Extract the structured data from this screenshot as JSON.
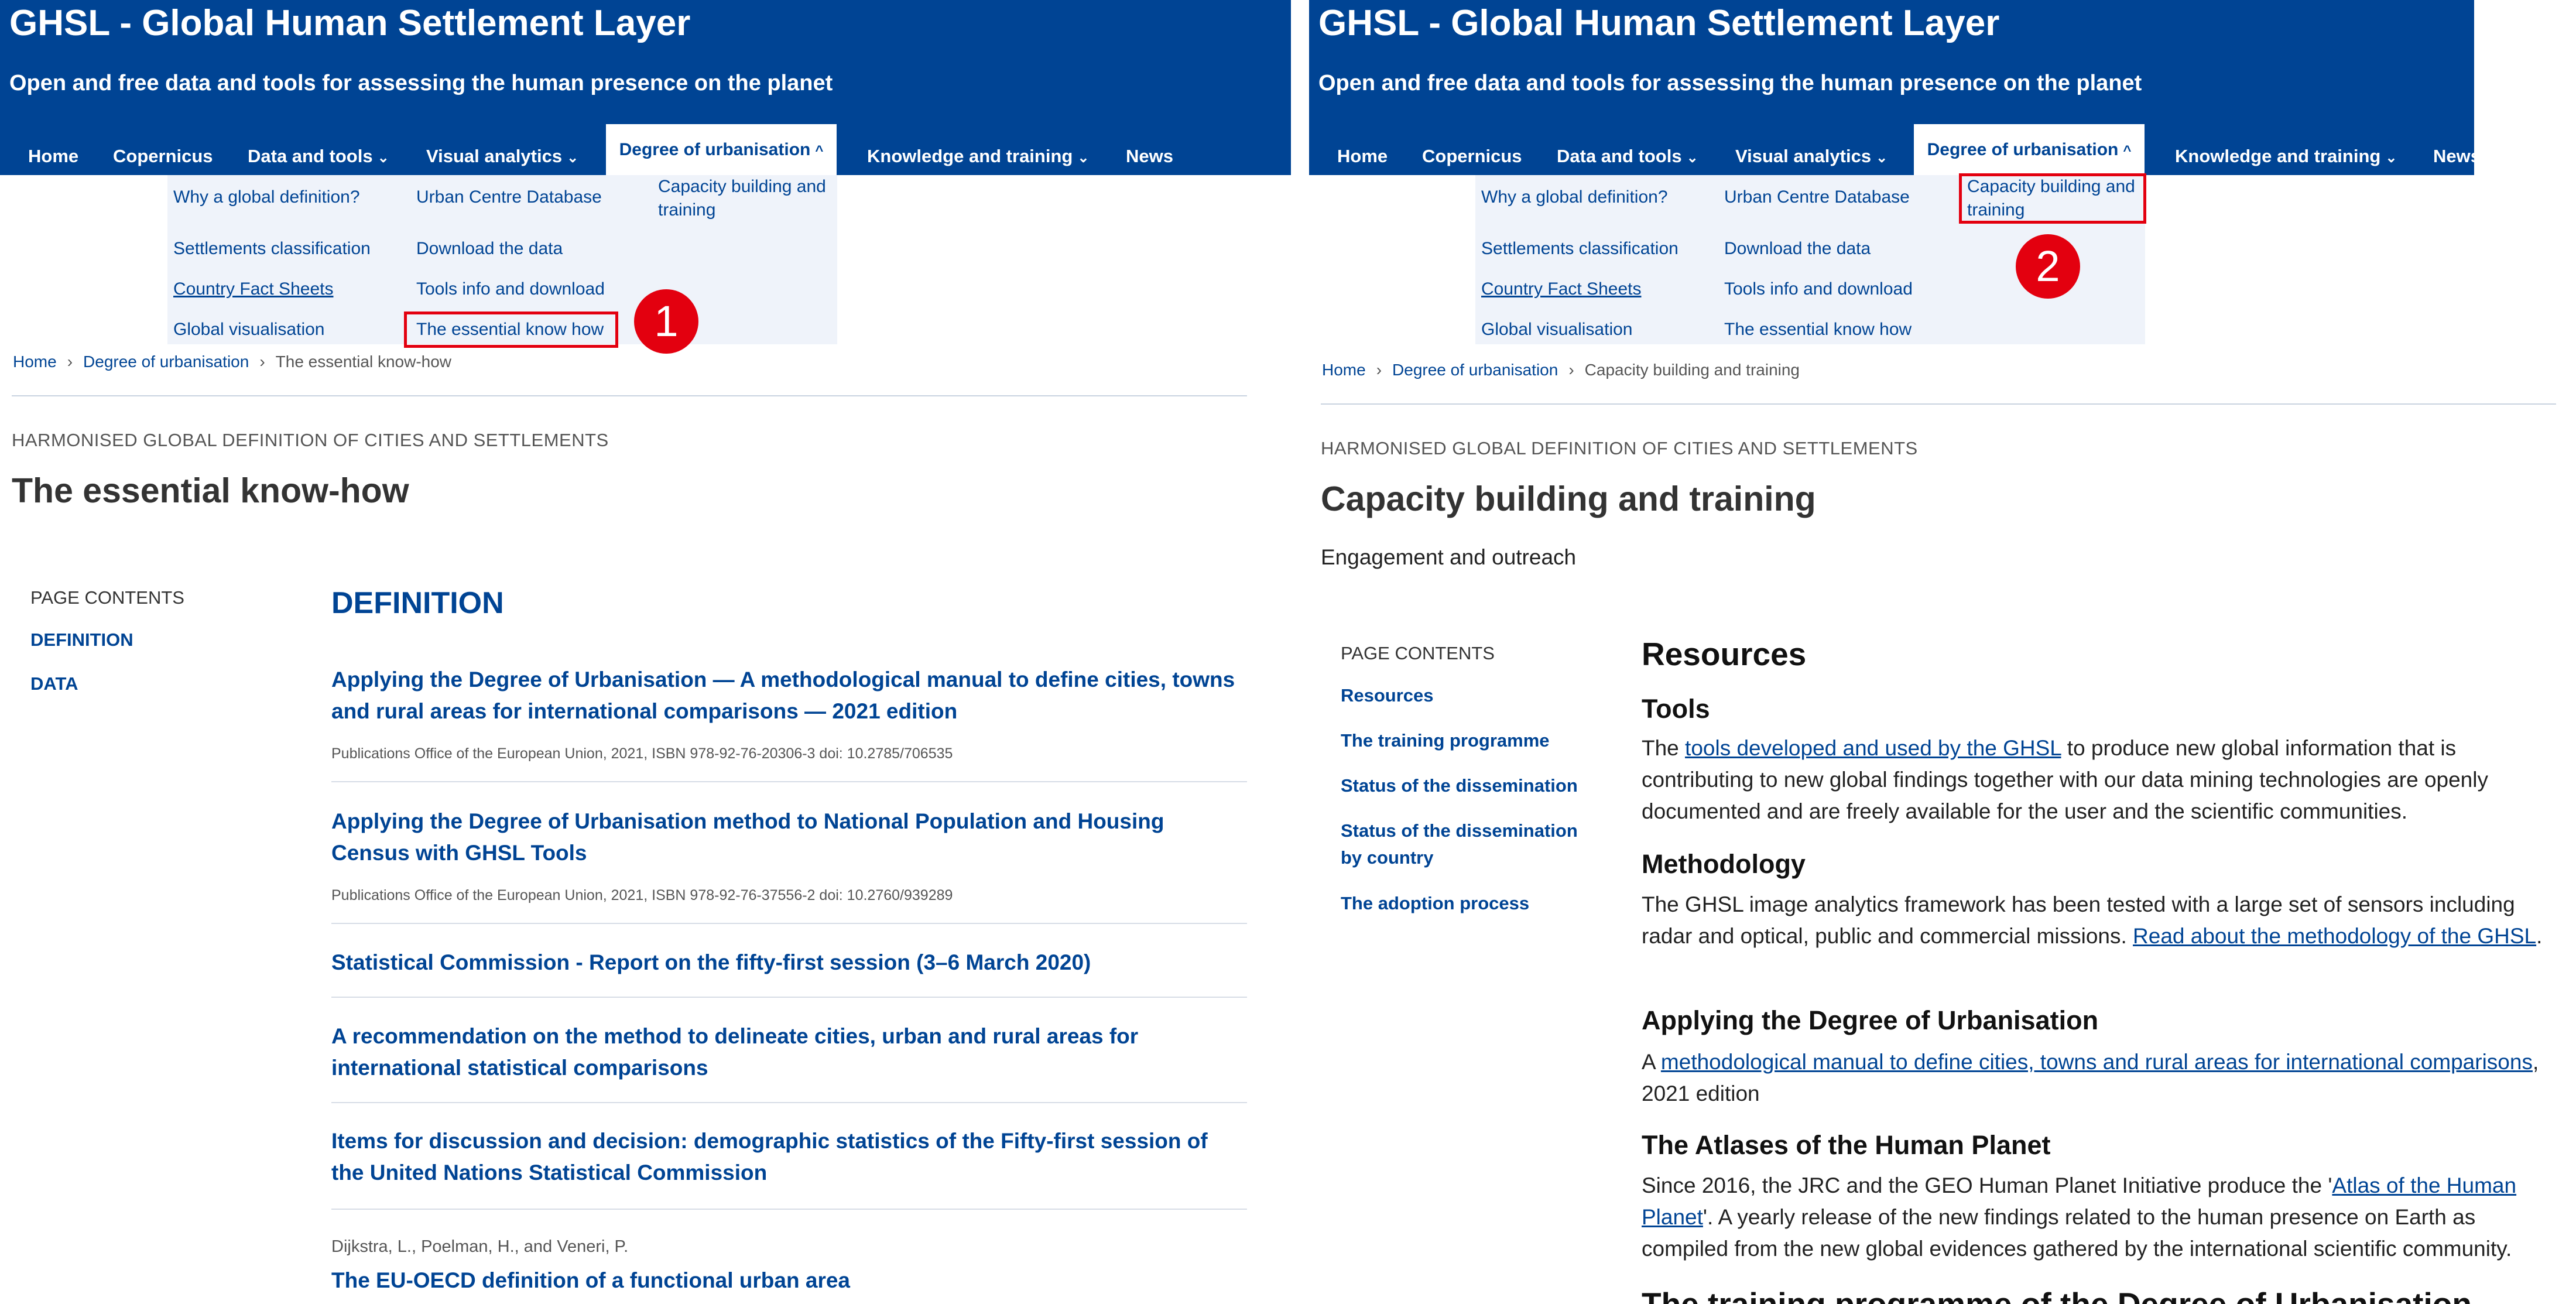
{
  "site": {
    "title": "GHSL - Global Human Settlement Layer",
    "subtitle": "Open and free data and tools for assessing the human presence on the planet"
  },
  "nav": {
    "home": "Home",
    "copernicus": "Copernicus",
    "data_tools": "Data and tools",
    "visual_analytics": "Visual analytics",
    "degree": "Degree of urbanisation",
    "knowledge": "Knowledge and training",
    "news": "News",
    "chevron_down": "⌄",
    "chevron_up": "^"
  },
  "dropdown": {
    "why": "Why a global definition?",
    "settlements": "Settlements classification",
    "fact_sheets": "Country Fact Sheets",
    "global_vis": "Global visualisation",
    "ucdb": "Urban Centre Database",
    "download": "Download the data",
    "tools_info": "Tools info and download",
    "essential": "The essential know how",
    "capacity": "Capacity building and training"
  },
  "markers": {
    "one": "1",
    "two": "2"
  },
  "icons": {
    "breadcrumb_separator": "›"
  },
  "left": {
    "breadcrumb": {
      "home": "Home",
      "parent": "Degree of urbanisation",
      "current": "The essential know-how"
    },
    "kicker": "HARMONISED GLOBAL DEFINITION OF CITIES AND SETTLEMENTS",
    "title": "The essential know-how",
    "page_contents": {
      "label": "PAGE CONTENTS",
      "items": [
        "DEFINITION",
        "DATA"
      ]
    },
    "section_title": "DEFINITION",
    "publications": [
      {
        "title": "Applying the Degree of Urbanisation — A methodological manual to define cities, towns and rural areas for international comparisons — 2021 edition",
        "meta": "Publications Office of the European Union, 2021, ISBN 978-92-76-20306-3 doi: 10.2785/706535"
      },
      {
        "title": "Applying the Degree of Urbanisation method to National Population and Housing Census with GHSL Tools",
        "meta": "Publications Office of the European Union, 2021, ISBN 978-92-76-37556-2 doi: 10.2760/939289"
      },
      {
        "title": "Statistical Commission - Report on the fifty-first session (3–6 March 2020)"
      },
      {
        "title": "A recommendation on the method to delineate cities, urban and rural areas for international statistical comparisons"
      },
      {
        "title": "Items for discussion and decision: demographic statistics of the Fifty-first session of the United Nations Statistical Commission"
      }
    ],
    "author": "Dijkstra, L., Poelman, H., and Veneri, P.",
    "partial_title": "The EU-OECD definition of a functional urban area"
  },
  "right": {
    "breadcrumb": {
      "home": "Home",
      "parent": "Degree of urbanisation",
      "current": "Capacity building and training"
    },
    "kicker": "HARMONISED GLOBAL DEFINITION OF CITIES AND SETTLEMENTS",
    "title": "Capacity building and training",
    "subtitle": "Engagement and outreach",
    "page_contents": {
      "label": "PAGE CONTENTS",
      "items": [
        "Resources",
        "The training programme",
        "Status of the dissemination",
        "Status of the dissemination by country",
        "The adoption process"
      ]
    },
    "resources_title": "Resources",
    "tools": {
      "heading": "Tools",
      "pre": "The ",
      "link": "tools developed and used by the GHSL",
      "post": " to produce new global information that is contributing to new global findings together with our data mining technologies are openly documented and are freely available for the user and the scientific communities."
    },
    "methodology": {
      "heading": "Methodology",
      "text": "The GHSL image analytics framework has been tested with a large set of sensors including radar and optical, public and commercial missions. ",
      "link": "Read about the methodology of the GHSL",
      "post": "."
    },
    "applying": {
      "heading": "Applying the Degree of Urbanisation",
      "pre": "A ",
      "link": "methodological manual to define cities, towns and rural areas for international comparisons",
      "post": ", 2021 edition"
    },
    "atlases": {
      "heading": "The Atlases of the Human Planet",
      "pre": "Since 2016, the JRC and the GEO Human Planet Initiative produce the '",
      "link": "Atlas of the Human Planet",
      "post": "'. A yearly release of the new findings related to the human presence on Earth as compiled from the new global evidences gathered by the international scientific community."
    },
    "partial_heading": "The training programme of the Degree of Urbanisation"
  }
}
